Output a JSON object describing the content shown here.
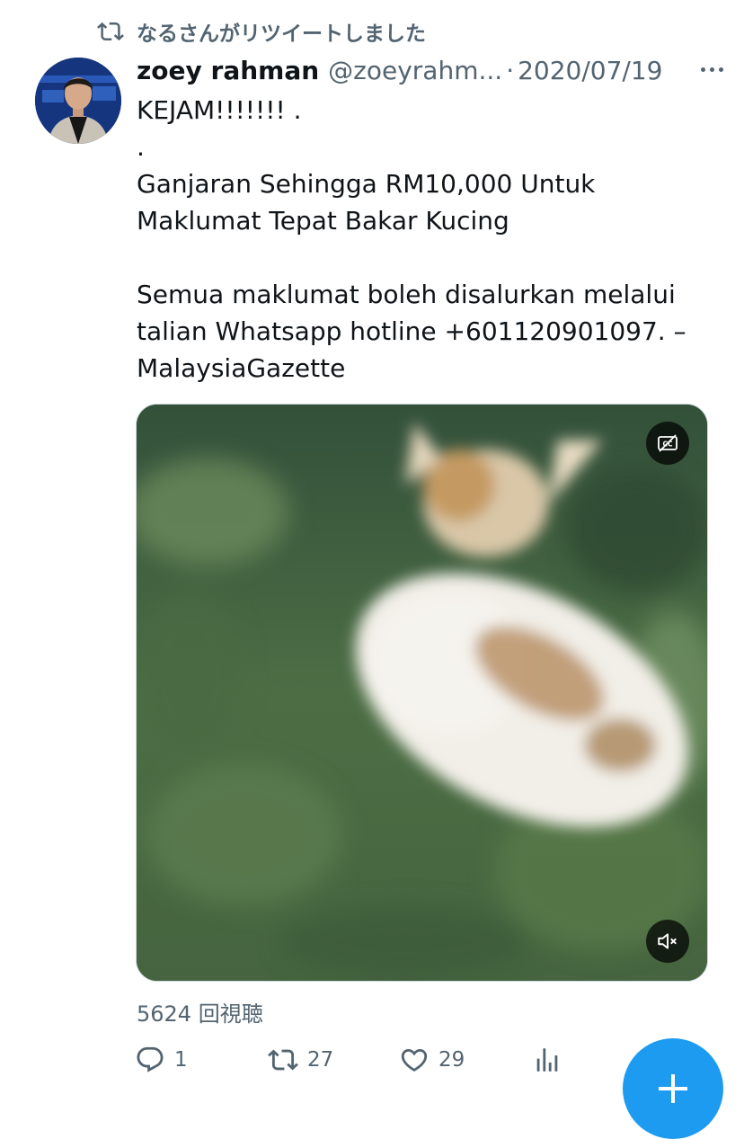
{
  "retweet": {
    "label": "なるさんがリツイートしました"
  },
  "tweet": {
    "author_name": "zoey rahman",
    "author_handle": "@zoeyrahm...",
    "separator": "·",
    "date": "2020/07/19",
    "text": "KEJAM!!!!!!! .\n.\nGanjaran Sehingga RM10,000 Untuk\nMaklumat Tepat Bakar Kucing\n\nSemua maklumat boleh disalurkan melalui\ntalian Whatsapp hotline +601120901097. –\nMalaysiaGazette",
    "view_count": "5624 回視聴"
  },
  "actions": {
    "reply_count": "1",
    "retweet_count": "27",
    "like_count": "29"
  },
  "icons": {
    "retweet": "retweet-icon",
    "more": "more-icon",
    "captions": "captions-icon",
    "mute": "mute-icon",
    "reply": "reply-icon",
    "like": "heart-icon",
    "analytics": "analytics-icon",
    "compose": "plus-icon"
  },
  "colors": {
    "accent": "#1d9bf0",
    "secondary_text": "#536471",
    "primary_text": "#0f1419"
  }
}
